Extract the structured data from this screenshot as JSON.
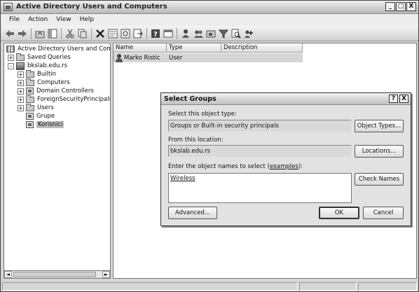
{
  "window": {
    "title": "Active Directory Users and Computers"
  },
  "window_controls": {
    "minimize": "_",
    "maximize": "□",
    "close": "X"
  },
  "menu": [
    "File",
    "Action",
    "View",
    "Help"
  ],
  "toolbar_icons": [
    "back-icon",
    "forward-icon",
    "up-icon",
    "show-hide-tree-icon",
    "cut-icon",
    "copy-icon",
    "delete-icon",
    "properties-icon",
    "refresh-icon",
    "export-icon",
    "help-icon",
    "console-icon",
    "new-user-icon",
    "new-group-icon",
    "new-ou-icon",
    "filter-icon",
    "find-icon",
    "add-to-group-icon"
  ],
  "tree": {
    "root": "Active Directory Users and Computers",
    "items": [
      {
        "label": "Saved Queries",
        "expander": "+"
      },
      {
        "label": "bkslab.edu.rs",
        "expander": "-"
      },
      {
        "label": "Builtin",
        "expander": "+"
      },
      {
        "label": "Computers",
        "expander": "+"
      },
      {
        "label": "Domain Controllers",
        "expander": "+"
      },
      {
        "label": "ForeignSecurityPrincipals",
        "expander": "+"
      },
      {
        "label": "Users",
        "expander": "+"
      },
      {
        "label": "Grupe",
        "expander": ""
      },
      {
        "label": "Korisnici",
        "expander": ""
      }
    ],
    "scroll_left": "◄",
    "scroll_right": "►"
  },
  "list": {
    "columns": [
      "Name",
      "Type",
      "Description"
    ],
    "rows": [
      {
        "name": "Marko Ristic",
        "type": "User",
        "description": ""
      }
    ]
  },
  "dialog": {
    "title": "Select Groups",
    "help_btn": "?",
    "close_btn": "X",
    "object_type_label": "Select this object type:",
    "object_type_value": "Groups or Built-in security principals",
    "object_types_button": "Object Types...",
    "location_label": "From this location:",
    "location_value": "bkslab.edu.rs",
    "locations_button": "Locations...",
    "names_label_prefix": "Enter the object names to select (",
    "names_label_link": "examples",
    "names_label_suffix": "):",
    "names_value": "Wireless",
    "check_names_button": "Check Names",
    "advanced_button": "Advanced...",
    "ok_button": "OK",
    "cancel_button": "Cancel"
  }
}
